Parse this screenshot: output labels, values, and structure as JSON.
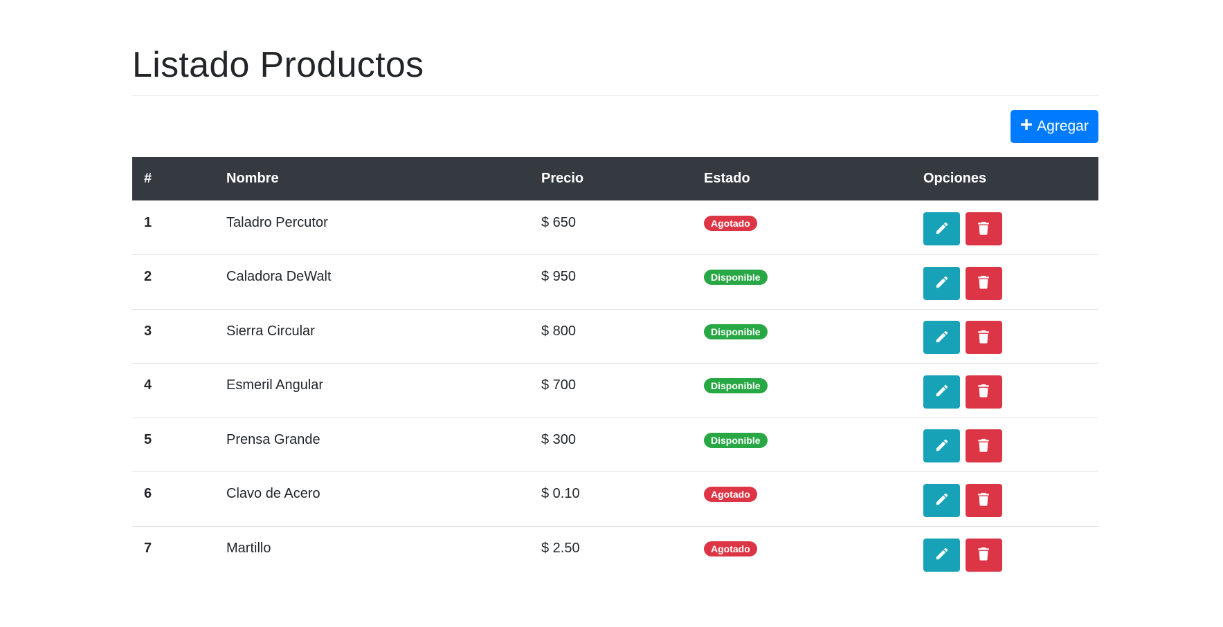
{
  "page": {
    "title": "Listado Productos"
  },
  "toolbar": {
    "add_label": "Agregar",
    "add_icon": "plus-icon",
    "add_color": "#007bff"
  },
  "table": {
    "headers": [
      "#",
      "Nombre",
      "Precio",
      "Estado",
      "Opciones"
    ],
    "header_bg": "#343a40",
    "rows": [
      {
        "id": "1",
        "name": "Taladro Percutor",
        "price": "$ 650",
        "status": "Agotado",
        "status_color": "#dc3545"
      },
      {
        "id": "2",
        "name": "Caladora DeWalt",
        "price": "$ 950",
        "status": "Disponible",
        "status_color": "#28a745"
      },
      {
        "id": "3",
        "name": "Sierra Circular",
        "price": "$ 800",
        "status": "Disponible",
        "status_color": "#28a745"
      },
      {
        "id": "4",
        "name": "Esmeril Angular",
        "price": "$ 700",
        "status": "Disponible",
        "status_color": "#28a745"
      },
      {
        "id": "5",
        "name": "Prensa Grande",
        "price": "$ 300",
        "status": "Disponible",
        "status_color": "#28a745"
      },
      {
        "id": "6",
        "name": "Clavo de Acero",
        "price": "$ 0.10",
        "status": "Agotado",
        "status_color": "#dc3545"
      },
      {
        "id": "7",
        "name": "Martillo",
        "price": "$ 2.50",
        "status": "Agotado",
        "status_color": "#dc3545"
      }
    ],
    "edit_icon": "pencil-icon",
    "delete_icon": "trash-icon",
    "edit_color": "#17a2b8",
    "delete_color": "#dc3545"
  }
}
